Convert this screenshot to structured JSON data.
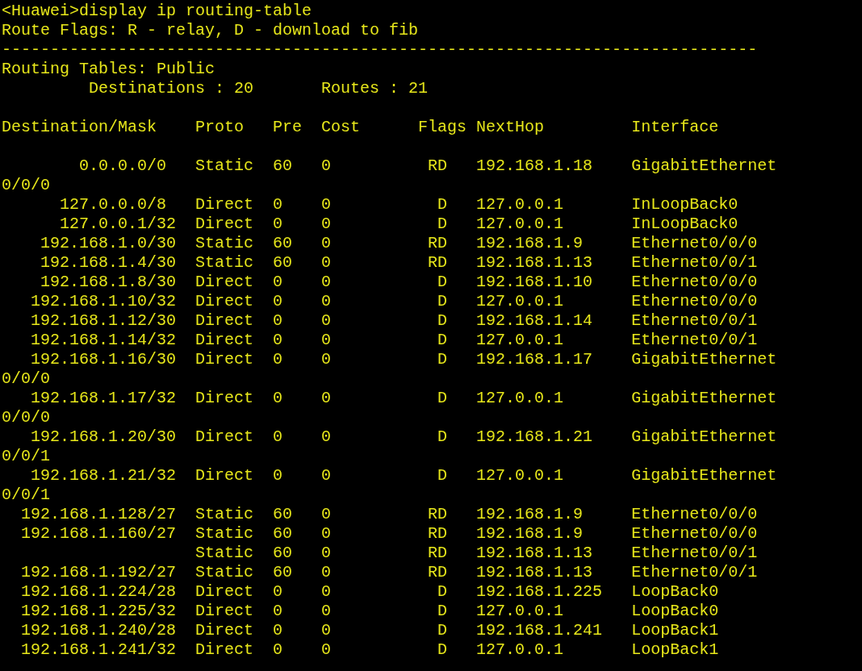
{
  "terminal": {
    "blocks": [
      [
        "<Huawei>display ip routing-table",
        "Route Flags: R - relay, D - download to fib",
        "------------------------------------------------------------------------------",
        "Routing Tables: Public",
        "         Destinations : 20       Routes : 21"
      ],
      [
        "Destination/Mask    Proto   Pre  Cost      Flags NextHop         Interface"
      ],
      [
        "        0.0.0.0/0   Static  60   0          RD   192.168.1.18    GigabitEthernet",
        "0/0/0",
        "      127.0.0.0/8   Direct  0    0           D   127.0.0.1       InLoopBack0",
        "      127.0.0.1/32  Direct  0    0           D   127.0.0.1       InLoopBack0",
        "    192.168.1.0/30  Static  60   0          RD   192.168.1.9     Ethernet0/0/0",
        "    192.168.1.4/30  Static  60   0          RD   192.168.1.13    Ethernet0/0/1",
        "    192.168.1.8/30  Direct  0    0           D   192.168.1.10    Ethernet0/0/0",
        "   192.168.1.10/32  Direct  0    0           D   127.0.0.1       Ethernet0/0/0",
        "   192.168.1.12/30  Direct  0    0           D   192.168.1.14    Ethernet0/0/1",
        "   192.168.1.14/32  Direct  0    0           D   127.0.0.1       Ethernet0/0/1",
        "   192.168.1.16/30  Direct  0    0           D   192.168.1.17    GigabitEthernet",
        "0/0/0",
        "   192.168.1.17/32  Direct  0    0           D   127.0.0.1       GigabitEthernet",
        "0/0/0",
        "   192.168.1.20/30  Direct  0    0           D   192.168.1.21    GigabitEthernet",
        "0/0/1",
        "   192.168.1.21/32  Direct  0    0           D   127.0.0.1       GigabitEthernet",
        "0/0/1",
        "  192.168.1.128/27  Static  60   0          RD   192.168.1.9     Ethernet0/0/0",
        "  192.168.1.160/27  Static  60   0          RD   192.168.1.9     Ethernet0/0/0",
        "                    Static  60   0          RD   192.168.1.13    Ethernet0/0/1",
        "  192.168.1.192/27  Static  60   0          RD   192.168.1.13    Ethernet0/0/1",
        "  192.168.1.224/28  Direct  0    0           D   192.168.1.225   LoopBack0",
        "  192.168.1.225/32  Direct  0    0           D   127.0.0.1       LoopBack0",
        "  192.168.1.240/28  Direct  0    0           D   192.168.1.241   LoopBack1",
        "  192.168.1.241/32  Direct  0    0           D   127.0.0.1       LoopBack1"
      ]
    ]
  }
}
